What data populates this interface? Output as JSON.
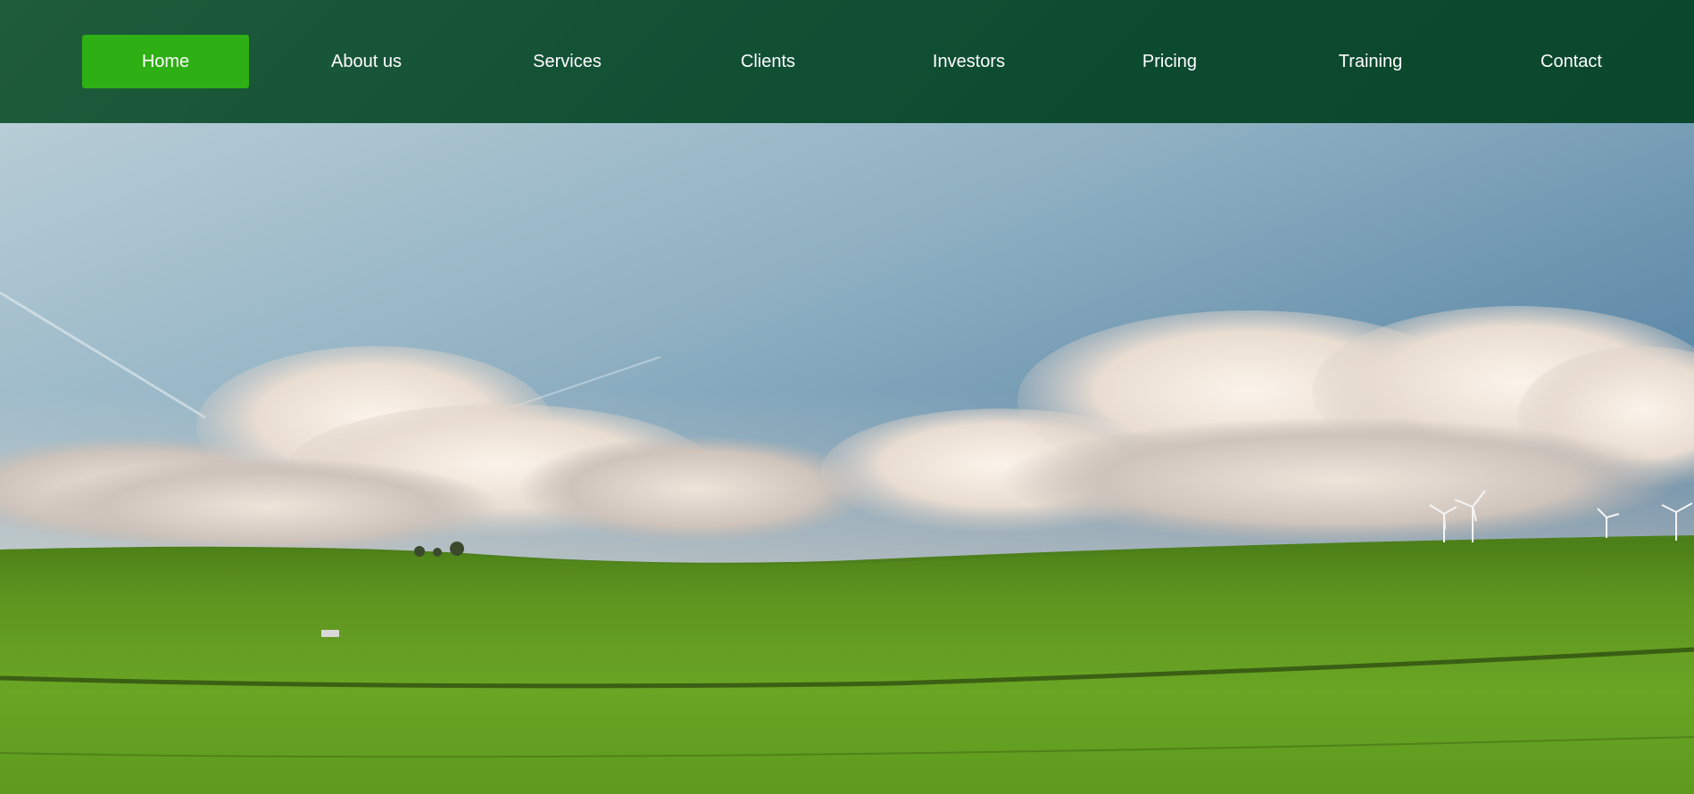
{
  "nav": {
    "items": [
      {
        "label": "Home",
        "active": true
      },
      {
        "label": "About us",
        "active": false
      },
      {
        "label": "Services",
        "active": false
      },
      {
        "label": "Clients",
        "active": false
      },
      {
        "label": "Investors",
        "active": false
      },
      {
        "label": "Pricing",
        "active": false
      },
      {
        "label": "Training",
        "active": false
      },
      {
        "label": "Contact",
        "active": false
      }
    ]
  },
  "colors": {
    "nav_background": "#0c4a30",
    "active_item": "#2eaf14",
    "nav_text": "#ffffff"
  },
  "hero": {
    "image": "landscape-photo"
  }
}
